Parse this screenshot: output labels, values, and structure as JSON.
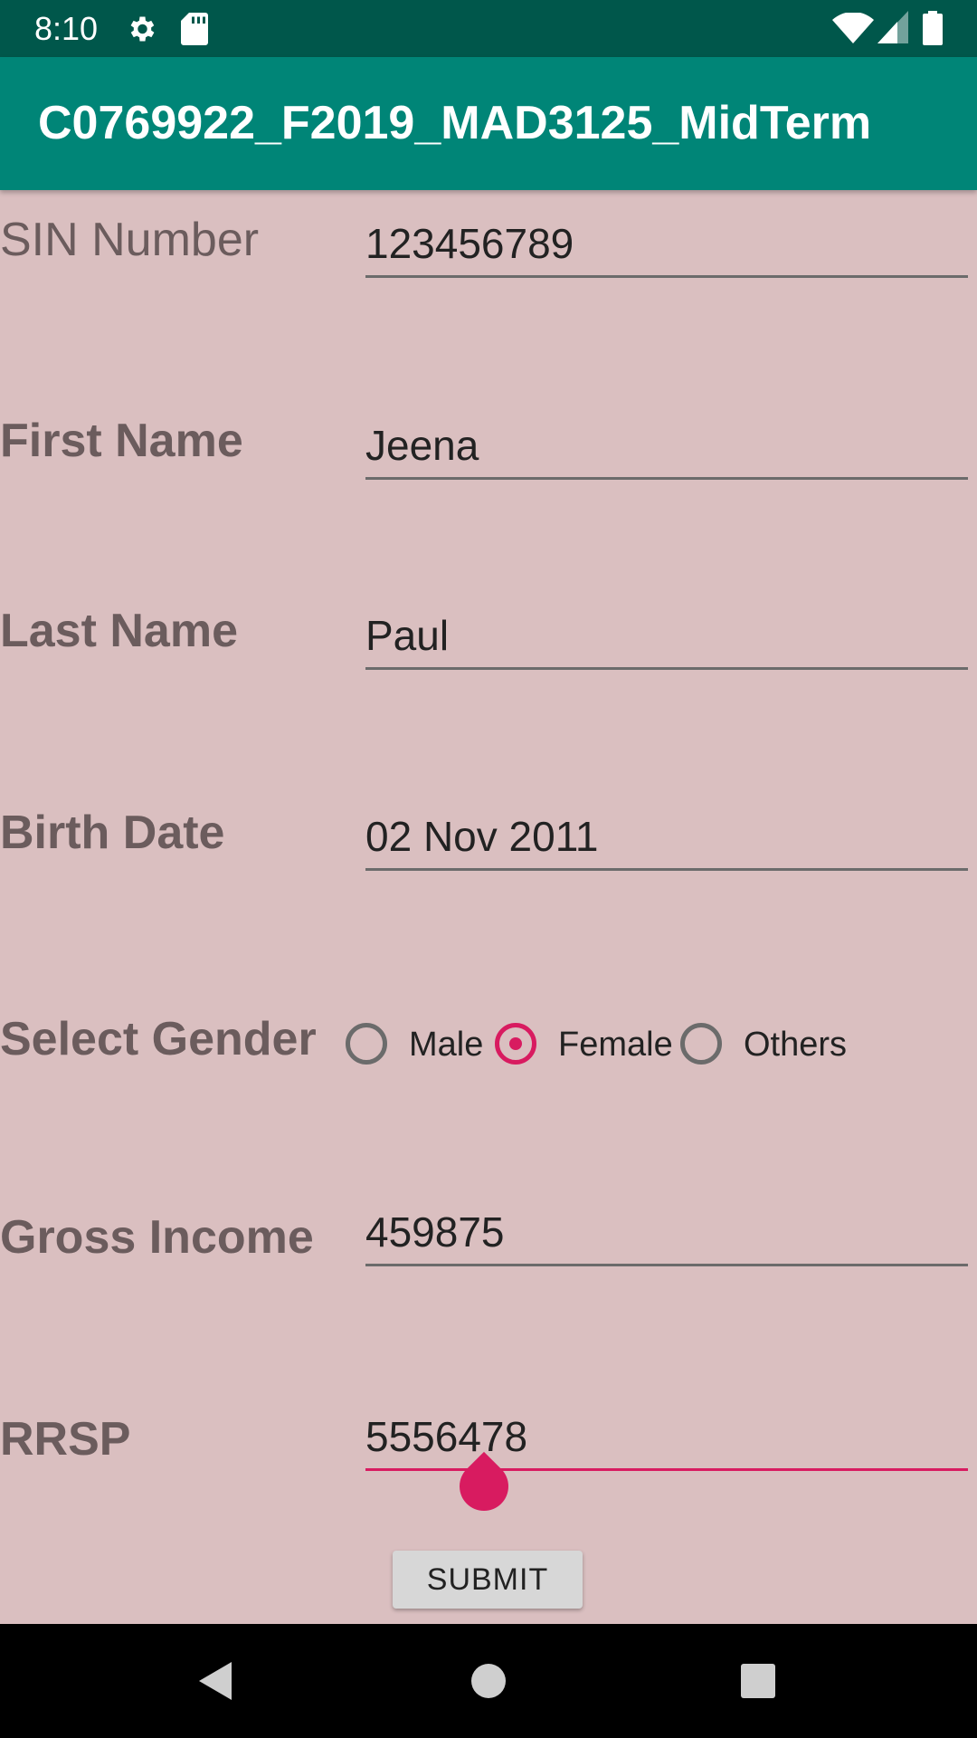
{
  "status_bar": {
    "time": "8:10",
    "icons": [
      "settings-icon",
      "sd-card-icon",
      "wifi-icon",
      "signal-icon",
      "battery-icon"
    ]
  },
  "app_bar": {
    "title": "C0769922_F2019_MAD3125_MidTerm",
    "color": "#008577"
  },
  "form": {
    "sin": {
      "label": "SIN Number",
      "value": "123456789"
    },
    "first_name": {
      "label": "First Name",
      "value": "Jeena"
    },
    "last_name": {
      "label": "Last Name",
      "value": "Paul"
    },
    "birth_date": {
      "label": "Birth Date",
      "value": "02 Nov 2011"
    },
    "gender": {
      "label": "Select Gender",
      "options": [
        "Male",
        "Female",
        "Others"
      ],
      "selected": "Female"
    },
    "gross_income": {
      "label": "Gross Income",
      "value": "459875"
    },
    "rrsp": {
      "label": "RRSP",
      "value": "5556478"
    },
    "submit_label": "SUBMIT"
  },
  "colors": {
    "background": "#dabfc0",
    "accent": "#d81b60",
    "primary_dark": "#00574b"
  },
  "nav_bar": {
    "icons": [
      "back-icon",
      "home-icon",
      "recents-icon"
    ]
  }
}
